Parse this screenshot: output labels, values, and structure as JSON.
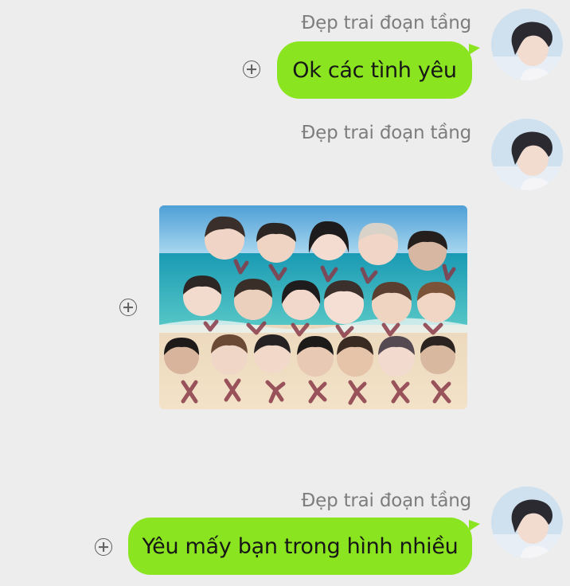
{
  "messages": [
    {
      "sender": "Đẹp trai đoạn tầng",
      "text": "Ok các tình yêu"
    },
    {
      "sender": "Đẹp trai đoạn tầng",
      "image": "beach-group-photo"
    },
    {
      "sender": "Đẹp trai đoạn tầng",
      "text": "Yêu mấy bạn trong hình nhiều"
    }
  ],
  "icons": {
    "add": "add-circle-icon",
    "avatar": "profile-avatar"
  },
  "colors": {
    "background": "#ededed",
    "bubble": "#8ae41f",
    "sender_text": "#7d7d7d",
    "message_text": "#171717"
  }
}
